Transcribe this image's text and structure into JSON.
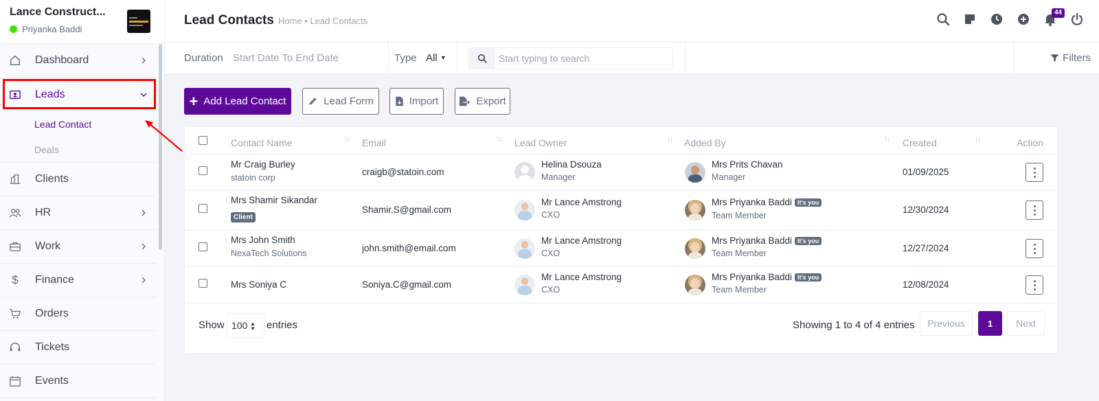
{
  "brand": {
    "name": "Lance Construct...",
    "user": "Priyanka Baddi"
  },
  "sidebar": {
    "items": [
      {
        "label": "Dashboard",
        "icon": "home-icon",
        "chevron": "right"
      },
      {
        "label": "Leads",
        "icon": "contact-card-icon",
        "chevron": "down",
        "active": true
      },
      {
        "label": "Clients",
        "icon": "buildings-icon"
      },
      {
        "label": "HR",
        "icon": "users-icon",
        "chevron": "right"
      },
      {
        "label": "Work",
        "icon": "briefcase-icon",
        "chevron": "right"
      },
      {
        "label": "Finance",
        "icon": "dollar-icon",
        "chevron": "right"
      },
      {
        "label": "Orders",
        "icon": "cart-icon"
      },
      {
        "label": "Tickets",
        "icon": "headset-icon"
      },
      {
        "label": "Events",
        "icon": "calendar-icon"
      }
    ],
    "leads_sub": [
      {
        "label": "Lead Contact",
        "active": true
      },
      {
        "label": "Deals"
      }
    ]
  },
  "header": {
    "title": "Lead Contacts",
    "breadcrumb": "Home • Lead Contacts",
    "notification_count": "44"
  },
  "filterbar": {
    "duration_label": "Duration",
    "date_range": "Start Date To End Date",
    "type_label": "Type",
    "type_value": "All",
    "search_placeholder": "Start typing to search",
    "filters_label": "Filters"
  },
  "actions": {
    "add": "Add Lead Contact",
    "lead_form": "Lead Form",
    "import": "Import",
    "export": "Export"
  },
  "table": {
    "columns": [
      "Contact Name",
      "Email",
      "Lead Owner",
      "Added By",
      "Created",
      "Action"
    ],
    "rows": [
      {
        "name": "Mr Craig Burley",
        "company": "statoin corp",
        "email": "craigb@statoin.com",
        "owner_name": "Helina Dsouza",
        "owner_role": "Manager",
        "added_name": "Mrs Prits Chavan",
        "added_role": "Manager",
        "created": "01/09/2025"
      },
      {
        "name": "Mrs Shamir Sikandar",
        "badge": "Client",
        "email": "Shamir.S@gmail.com",
        "owner_name": "Mr Lance Amstrong",
        "owner_role": "CXO",
        "added_name": "Mrs Priyanka Baddi",
        "you": "It's you",
        "added_role": "Team Member",
        "created": "12/30/2024"
      },
      {
        "name": "Mrs John Smith",
        "company": "NexaTech Solutions",
        "email": "john.smith@email.com",
        "owner_name": "Mr Lance Amstrong",
        "owner_role": "CXO",
        "added_name": "Mrs Priyanka Baddi",
        "you": "It's you",
        "added_role": "Team Member",
        "created": "12/27/2024"
      },
      {
        "name": "Mrs Soniya C",
        "email": "Soniya.C@gmail.com",
        "owner_name": "Mr Lance Amstrong",
        "owner_role": "CXO",
        "added_name": "Mrs Priyanka Baddi",
        "you": "It's you",
        "added_role": "Team Member",
        "created": "12/08/2024"
      }
    ]
  },
  "footer": {
    "show_label": "Show",
    "page_size": "100",
    "entries_label": "entries",
    "showing": "Showing 1 to 4 of 4 entries",
    "previous": "Previous",
    "current_page": "1",
    "next": "Next"
  },
  "colors": {
    "accent": "#5d0a9b",
    "highlight": "#ff0000",
    "online": "#39e500"
  }
}
